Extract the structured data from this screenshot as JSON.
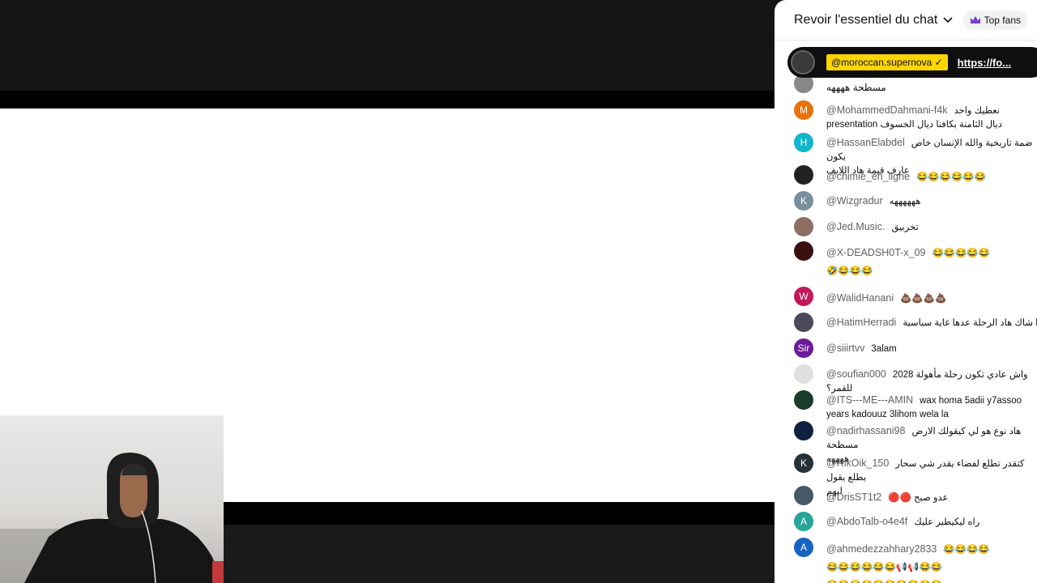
{
  "chat": {
    "title": "Revoir l'essentiel du chat",
    "top_fans_label": "Top fans",
    "pinned": {
      "author": "@moroccan.supernova ✓",
      "link": "https://fo..."
    },
    "partial_line": "مسطحة ههههه",
    "messages": [
      {
        "author": "@MohammedDahmani-f4k",
        "line1": "نعطيك واحد",
        "line2": "presentation ديال الثامنة بكافنا ديال الخسوف",
        "initial": "M",
        "color": "#e8710a"
      },
      {
        "author": "@HassanElabdel",
        "line1": "ضمة تاريخية والله الإنسان خاص يكون",
        "line2": "عارف قيمة هاد اللايف",
        "initial": "H",
        "color": "#12b5cb"
      },
      {
        "author": "@chimie_en_ligne",
        "line1": "😂😂😂😂😂😂",
        "initial": "",
        "color": "#222222"
      },
      {
        "author": "@Wizgradur",
        "line1": "ههههههه",
        "initial": "K",
        "color": "#78909c"
      },
      {
        "author": "@Jed.Music.",
        "line1": "تخربيق",
        "initial": "",
        "color": "#8d6e63"
      },
      {
        "author": "@X-DEADSH0T-x_09",
        "line1": "😂😂😂😂😂",
        "line2": "🤣😂😂😂",
        "initial": "",
        "color": "#3b1010"
      },
      {
        "author": "@WalidHanani",
        "line1": "💩💩💩💩",
        "initial": "W",
        "color": "#c2185b"
      },
      {
        "author": "@HatimHerradi",
        "line1": "ادا شاك هاد الرحلة عدها غاية سياسية",
        "initial": "",
        "color": "#4a4a5a"
      },
      {
        "author": "@siiirtvv",
        "line1": "3alam",
        "initial": "Sir",
        "color": "#6a1b9a"
      },
      {
        "author": "@soufian000",
        "line1": "2028 واش عادي تكون رحلة مأهولة للقمر؟",
        "initial": "",
        "color": "#e0e0e0"
      },
      {
        "author": "@ITS---ME---AMIN",
        "line1": "wax homa 5adii y7assoo",
        "line2": "years kadouuz 3lihom wela la",
        "initial": "",
        "color": "#1b3d2b"
      },
      {
        "author": "@nadirhassani98",
        "line1": "هاد نوع هو لي كيقولك الارض مسطحة",
        "line2": "ههههه",
        "initial": "",
        "color": "#102040"
      },
      {
        "author": "@RikOik_150",
        "line1": "كتقدر تطلع لفضاء يقدر شي سحار يطلع يقول",
        "line2": "ليهم",
        "initial": "K",
        "color": "#263238"
      },
      {
        "author": "@DrisST1t2",
        "line1": "🔴🔴 عدو صبح",
        "initial": "",
        "color": "#455a64"
      },
      {
        "author": "@AbdoTalb-o4e4f",
        "line1": "راه ليكيطير عليك",
        "initial": "A",
        "color": "#26a69a"
      },
      {
        "author": "@ahmedezzahhary2833",
        "line1": "😂😂😂😂",
        "line2": "😂😂😂😂😂😂📢📢😂😂",
        "line3": "😂😂😂😂😂😂😂😂😂😂",
        "initial": "A",
        "color": "#1565c0"
      }
    ]
  }
}
